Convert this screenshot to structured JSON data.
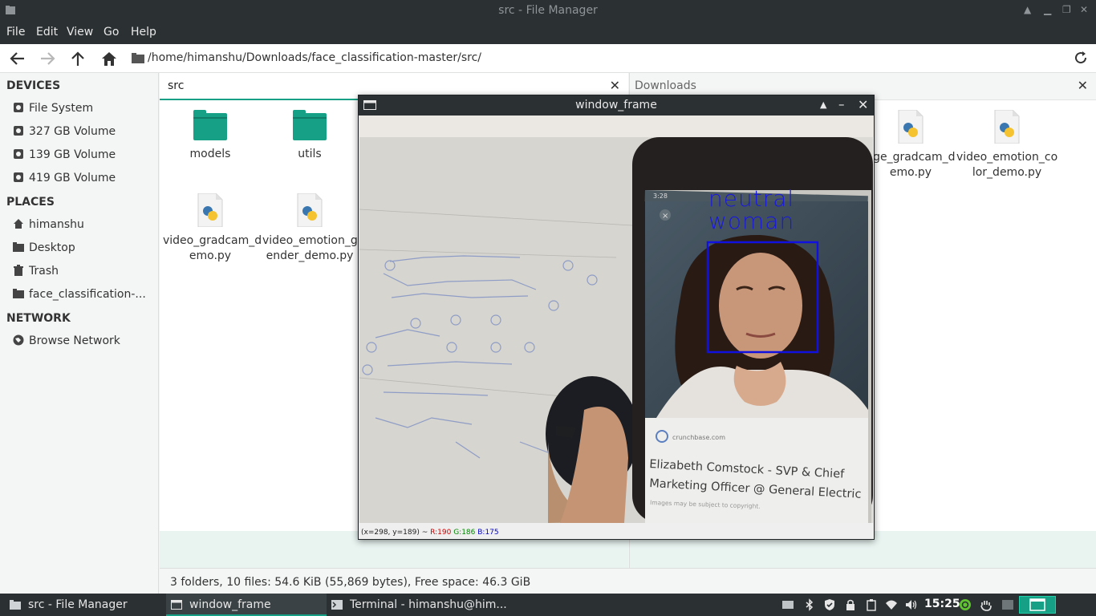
{
  "window": {
    "title": "src - File Manager"
  },
  "menu": [
    "File",
    "Edit",
    "View",
    "Go",
    "Help"
  ],
  "path": "/home/himanshu/Downloads/face_classification-master/src/",
  "sidebar": {
    "devices_header": "DEVICES",
    "devices": [
      "File System",
      "327 GB Volume",
      "139 GB Volume",
      "419 GB Volume"
    ],
    "places_header": "PLACES",
    "places": [
      "himanshu",
      "Desktop",
      "Trash",
      "face_classification-..."
    ],
    "network_header": "NETWORK",
    "network": [
      "Browse Network"
    ]
  },
  "left_pane": {
    "tab_label": "src",
    "files": [
      {
        "name": "models",
        "type": "folder"
      },
      {
        "name": "utils",
        "type": "folder"
      },
      {
        "name": "video_gradcam_d emo.py",
        "line1": "video_gradcam_d",
        "line2": "emo.py",
        "type": "python"
      },
      {
        "name": "video_emotion_g ender_demo.py",
        "line1": "video_emotion_g",
        "line2": "ender_demo.py",
        "type": "python"
      }
    ]
  },
  "right_pane": {
    "tab_label": "Downloads",
    "files": [
      {
        "line1": "age_gradcam_d",
        "line2": "emo.py",
        "type": "python"
      },
      {
        "line1": "video_emotion_co",
        "line2": "lor_demo.py",
        "type": "python"
      }
    ]
  },
  "status": "3 folders, 10 files: 54.6 KiB (55,869 bytes), Free space: 46.3 GiB",
  "popup": {
    "title": "window_frame",
    "emotion_label": "neutral",
    "gender_label": "woman",
    "article_line1": "Elizabeth Comstock - SVP & Chief",
    "article_line2": "Marketing Officer @ General Electric",
    "source": "crunchbase.com",
    "copyright": "Images may be subject to copyright.",
    "phone_time": "3:28",
    "status_coords": "(x=298, y=189) ~",
    "status_r": "R:190",
    "status_g": "G:186",
    "status_b": "B:175"
  },
  "taskbar": {
    "tasks": [
      "src - File Manager",
      "window_frame",
      "Terminal - himanshu@him..."
    ],
    "clock": "15:25"
  },
  "colors": {
    "accent": "#16a085",
    "titlebar": "#2b3033",
    "face_box": "#1010e0"
  },
  "icons": [
    "folder-icon",
    "python-file-icon",
    "drive-icon",
    "home-icon",
    "trash-icon",
    "network-icon"
  ]
}
